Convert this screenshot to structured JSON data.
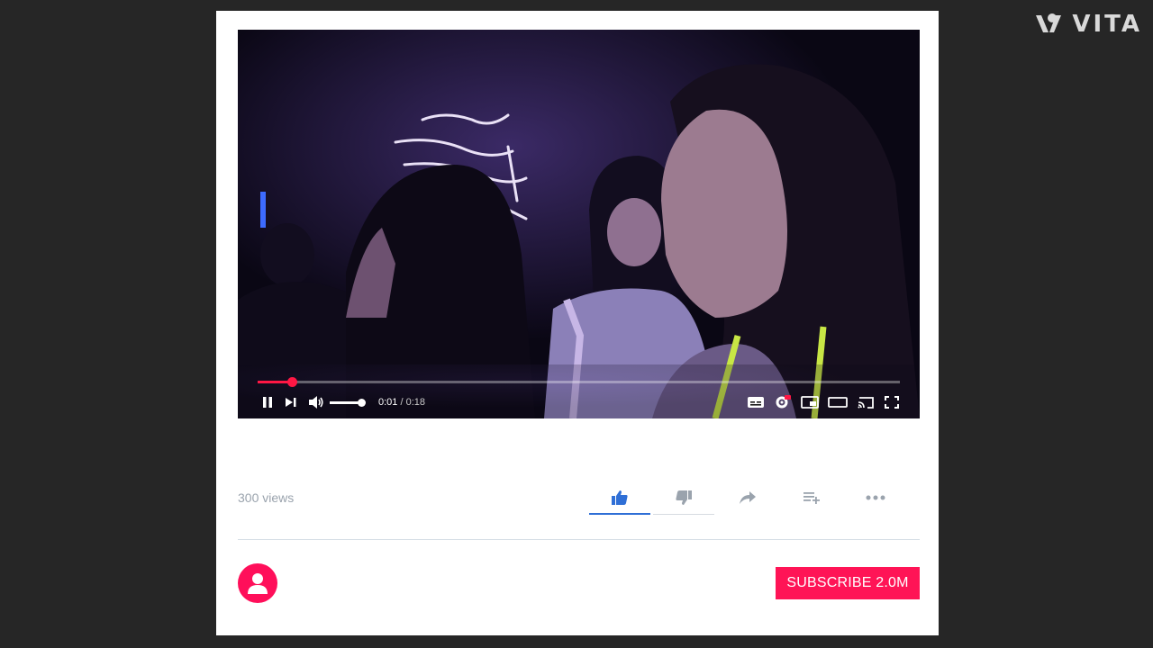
{
  "watermark": {
    "text": "VITA"
  },
  "player": {
    "current_time": "0:01",
    "separator": " / ",
    "duration": "0:18",
    "progress": 0.053,
    "volume": 1.0,
    "state": "playing"
  },
  "meta": {
    "views": "300 views"
  },
  "actions": {
    "icons": [
      "like-icon",
      "dislike-icon",
      "share-icon",
      "add-to-playlist-icon",
      "more-icon"
    ],
    "selected": "like"
  },
  "channel": {
    "subscribe_label": "SUBSCRIBE 2.0M"
  },
  "colors": {
    "accent": "#ff1456",
    "progress": "#ff1744",
    "like_active": "#2f6fd6",
    "muted_text": "#9aa3ad",
    "background": "#262626"
  }
}
